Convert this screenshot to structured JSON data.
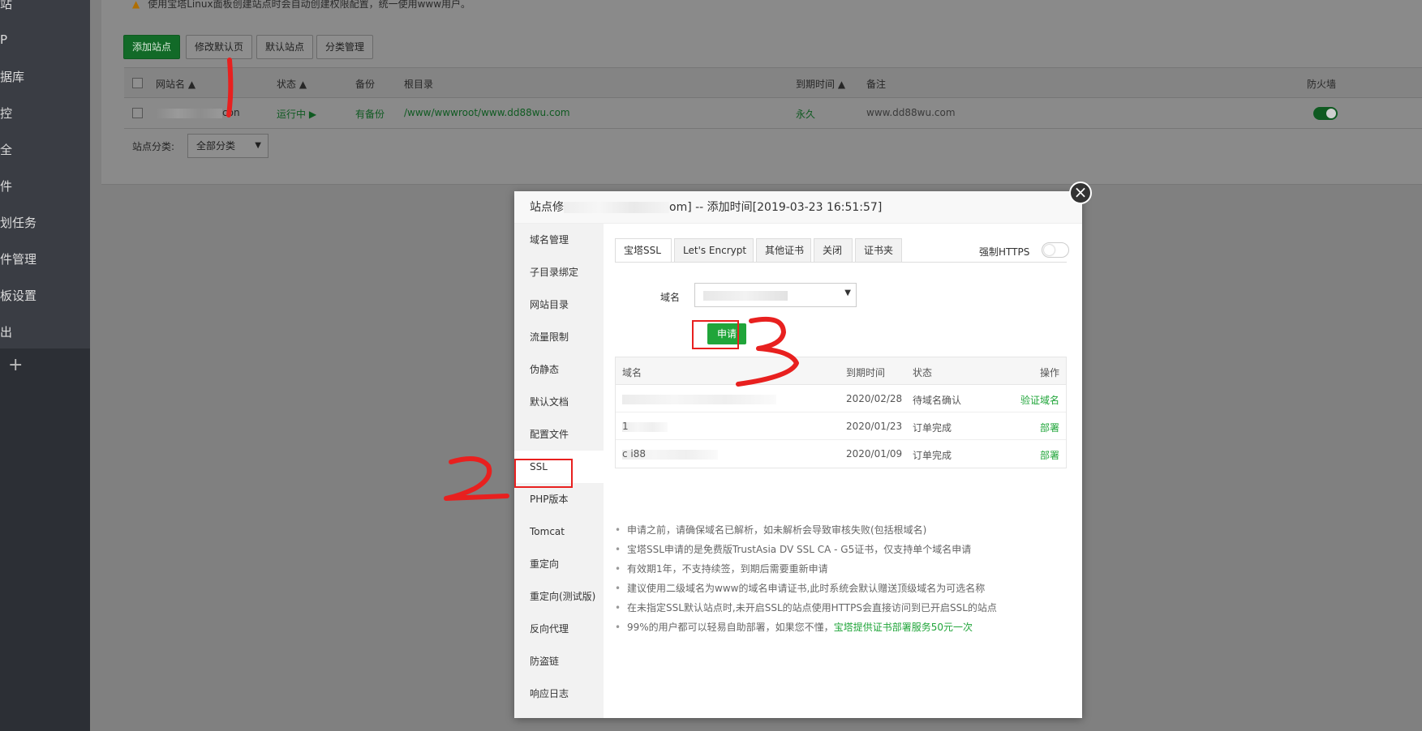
{
  "sidebar": {
    "items": [
      "站",
      "P",
      "据库",
      "控",
      "全",
      "件",
      "划任务",
      "件管理",
      "板设置",
      "出"
    ],
    "plus": "+"
  },
  "panel": {
    "notice": "使用宝塔Linux面板创建站点时会自动创建权限配置，统一使用www用户。",
    "toolbar": {
      "add_site": "添加站点",
      "edit_default_page": "修改默认页",
      "default_site": "默认站点",
      "category_manage": "分类管理"
    },
    "table": {
      "headers": {
        "site_name": "网站名 ▲",
        "status": "状态 ▲",
        "backup": "备份",
        "root": "根目录",
        "expire": "到期时间 ▲",
        "note": "备注",
        "firewall": "防火墙"
      },
      "row": {
        "site_suffix": "con",
        "status": "运行中 ▶",
        "backup": "有备份",
        "root": "/www/wwwroot/www.dd88wu.com",
        "expire": "永久",
        "note": "www.dd88wu.com"
      }
    },
    "category_label": "站点分类:",
    "category_value": "全部分类"
  },
  "modal": {
    "title_prefix": "站点修",
    "title_suffix": "om] -- 添加时间[2019-03-23 16:51:57]",
    "close": "×",
    "side_items": [
      "域名管理",
      "子目录绑定",
      "网站目录",
      "流量限制",
      "伪静态",
      "默认文档",
      "配置文件",
      "SSL",
      "PHP版本",
      "Tomcat",
      "重定向",
      "重定向(测试版)",
      "反向代理",
      "防盗链",
      "响应日志"
    ],
    "tabs": [
      "宝塔SSL",
      "Let's Encrypt",
      "其他证书",
      "关闭",
      "证书夹"
    ],
    "force_https": "强制HTTPS",
    "domain_label": "域名",
    "apply_button": "申请",
    "cert_table": {
      "headers": [
        "域名",
        "到期时间",
        "状态",
        "操作"
      ],
      "rows": [
        {
          "domain": "",
          "expire": "2020/02/28",
          "status": "待域名确认",
          "action": "验证域名"
        },
        {
          "domain": "1",
          "expire": "2020/01/23",
          "status": "订单完成",
          "action": "部署"
        },
        {
          "domain": "c        i88",
          "expire": "2020/01/09",
          "status": "订单完成",
          "action": "部署"
        }
      ]
    },
    "tips": [
      "申请之前，请确保域名已解析，如未解析会导致审核失败(包括根域名)",
      "宝塔SSL申请的是免费版TrustAsia DV SSL CA - G5证书，仅支持单个域名申请",
      "有效期1年，不支持续签，到期后需要重新申请",
      "建议使用二级域名为www的域名申请证书,此时系统会默认赠送顶级域名为可选名称",
      "在未指定SSL默认站点时,未开启SSL的站点使用HTTPS会直接访问到已开启SSL的站点"
    ],
    "last_tip_prefix": "99%的用户都可以轻易自助部署，如果您不懂，",
    "last_tip_link": "宝塔提供证书部署服务50元一次"
  },
  "colors": {
    "accent": "#20a53a",
    "annotation": "#e8201f"
  }
}
